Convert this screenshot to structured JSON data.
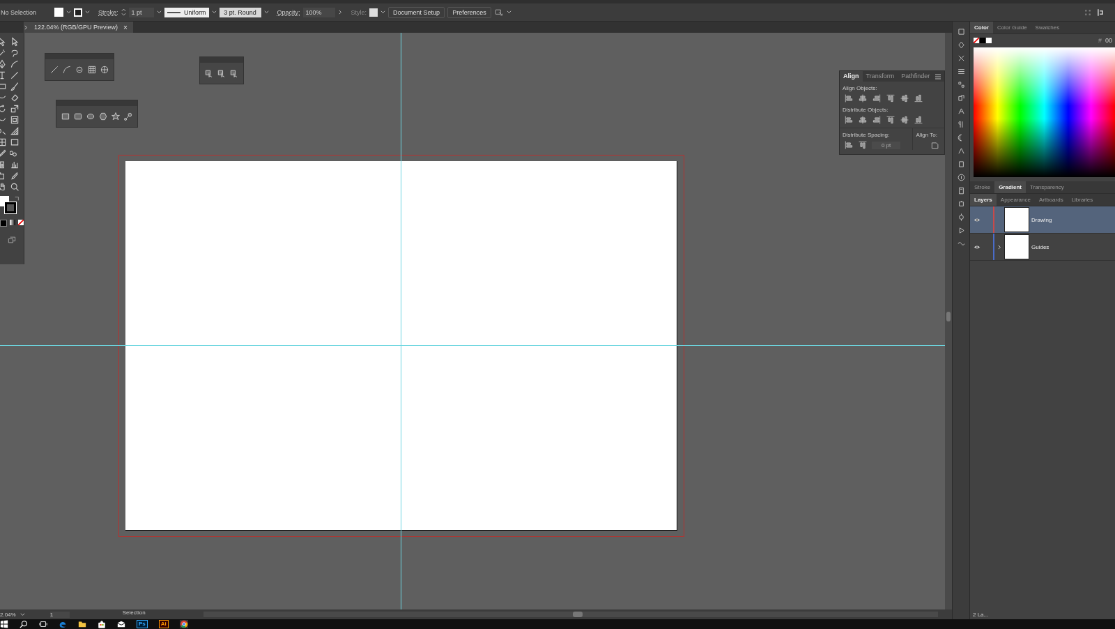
{
  "control_bar": {
    "selection": "No Selection",
    "stroke_label": "Stroke:",
    "stroke_weight": "1 pt",
    "profile": "Uniform",
    "brush": "3 pt. Round",
    "opacity_label": "Opacity:",
    "opacity": "100%",
    "style_label": "Style:",
    "buttons": [
      "Document Setup",
      "Preferences"
    ]
  },
  "document_tab": {
    "title": "122.04% (RGB/GPU Preview)",
    "close": "×"
  },
  "align_panel": {
    "tabs": [
      {
        "label": "Align",
        "selected": true
      },
      {
        "label": "Transform",
        "selected": false
      },
      {
        "label": "Pathfinder",
        "selected": false
      }
    ],
    "align_objects": "Align Objects:",
    "distribute_objects": "Distribute Objects:",
    "distribute_spacing": "Distribute Spacing:",
    "spacing_value": "0 pt",
    "align_to": "Align To:"
  },
  "color_panel": {
    "tabs": [
      {
        "label": "Color",
        "selected": true
      },
      {
        "label": "Color Guide",
        "selected": false
      },
      {
        "label": "Swatches",
        "selected": false
      }
    ],
    "hex_prefix": "#",
    "hex": "00"
  },
  "mid_tabs": [
    {
      "label": "Stroke",
      "selected": false
    },
    {
      "label": "Gradient",
      "selected": true
    },
    {
      "label": "Transparency",
      "selected": false
    }
  ],
  "layers_panel": {
    "tabs": [
      {
        "label": "Layers",
        "selected": true
      },
      {
        "label": "Appearance",
        "selected": false
      },
      {
        "label": "Artboards",
        "selected": false
      },
      {
        "label": "Libraries",
        "selected": false
      }
    ],
    "layers": [
      {
        "name": "Drawing",
        "selected": true,
        "color": "#c84a4a",
        "expandable": false
      },
      {
        "name": "Guides",
        "selected": false,
        "color": "#4a6cc8",
        "expandable": true
      }
    ],
    "footer": "2 La..."
  },
  "status_bar": {
    "zoom": "2.04%",
    "artboard": "1",
    "tool": "Selection"
  },
  "taskbar": {
    "photoshop": "Ps",
    "illustrator": "Ai"
  }
}
